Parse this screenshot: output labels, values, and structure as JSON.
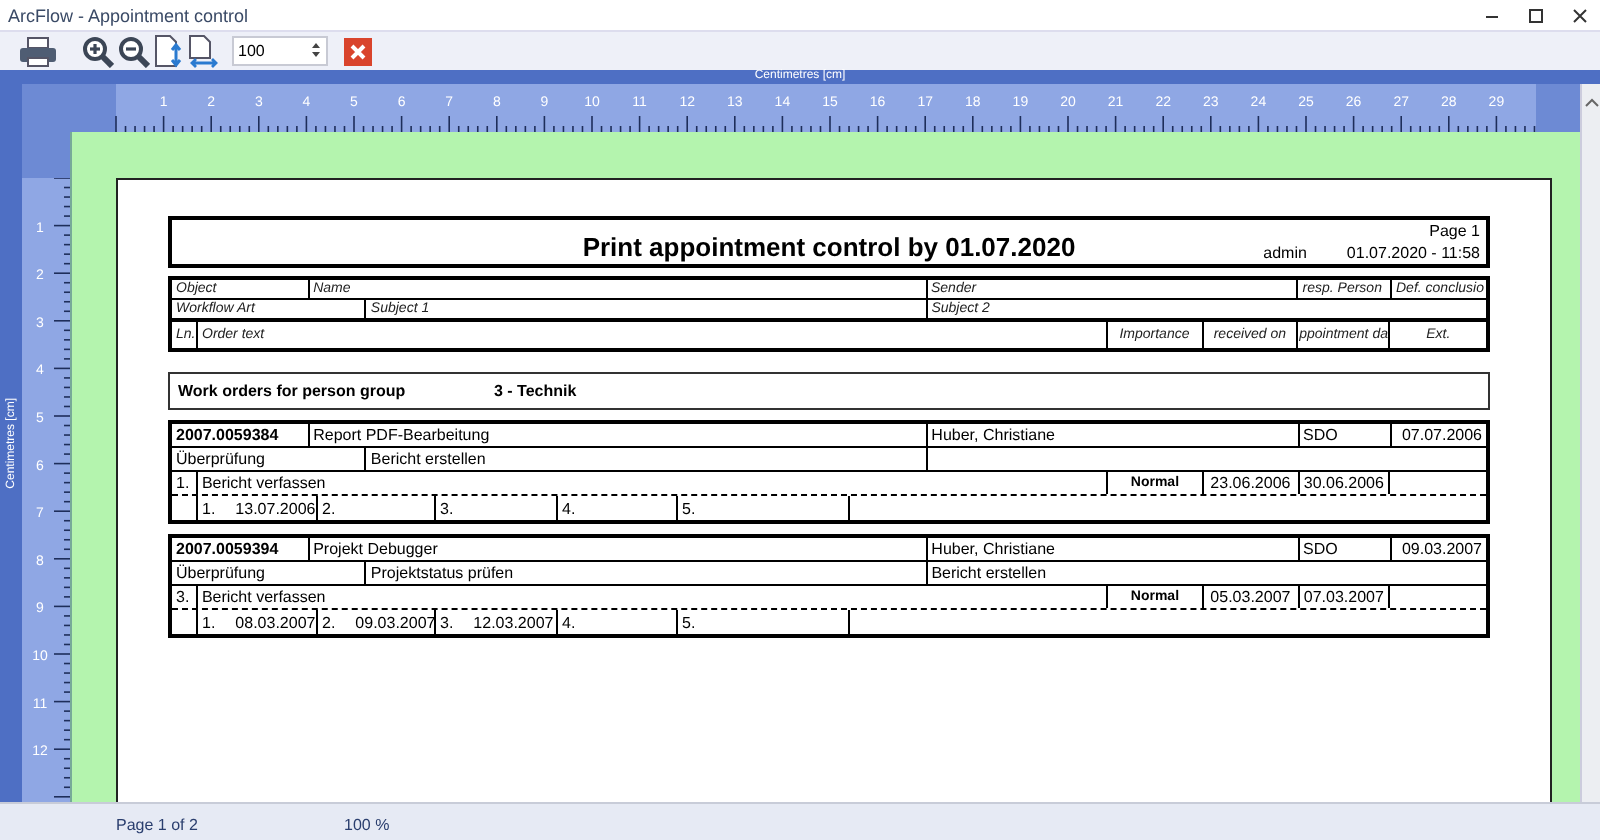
{
  "window": {
    "title": "ArcFlow - Appointment control"
  },
  "toolbar": {
    "zoom_value": "100"
  },
  "rulers": {
    "horizontal_label": "Centimetres [cm]",
    "horizontal_numbers": [
      "1",
      "2",
      "3",
      "4",
      "5",
      "6",
      "7",
      "8",
      "9",
      "10",
      "11",
      "12",
      "13",
      "14",
      "15",
      "16",
      "17",
      "18",
      "19",
      "20",
      "21",
      "22",
      "23",
      "24",
      "25",
      "26",
      "27",
      "28",
      "29"
    ],
    "vertical_label": "Centimetres [cm]",
    "vertical_numbers": [
      "1",
      "2",
      "3",
      "4",
      "5",
      "6",
      "7",
      "8",
      "9",
      "10",
      "11",
      "12"
    ]
  },
  "report": {
    "title": "Print appointment control by 01.07.2020",
    "page": "Page 1",
    "user": "admin",
    "timestamp": "01.07.2020 - 11:58",
    "column_headers": {
      "row_1": [
        "Object",
        "Name",
        "Sender",
        "resp. Person",
        "Def. conclusio"
      ],
      "row_2": [
        "Workflow Art",
        "Subject 1",
        "Subject 2"
      ],
      "row_3": [
        "Ln.",
        "Order text",
        "Importance",
        "received on",
        "ppointment da",
        "Ext."
      ]
    },
    "group": {
      "label": "Work orders for person group",
      "value": "3 - Technik"
    },
    "orders": [
      {
        "number": "2007.0059384",
        "name": "Report PDF-Bearbeitung",
        "sender": "Huber, Christiane",
        "person": "SDO",
        "date": "07.07.2006",
        "workflow_art": "Überprüfung",
        "subject_1": "Bericht erstellen",
        "line": "1.",
        "order_text": "Bericht verfassen",
        "importance": "Normal",
        "received_on": "23.06.2006",
        "appointment_date": "30.06.2006",
        "reminders": [
          {
            "number": "1.",
            "date": "13.07.2006"
          },
          {
            "number": "2."
          },
          {
            "number": "3."
          },
          {
            "number": "4."
          },
          {
            "number": "5."
          }
        ]
      },
      {
        "number": "2007.0059394",
        "name": "Projekt Debugger",
        "sender": "Huber, Christiane",
        "person": "SDO",
        "date": "09.03.2007",
        "workflow_art": "Überprüfung",
        "subject_1": "Projektstatus prüfen",
        "subject_2": "Bericht erstellen",
        "line": "3.",
        "order_text": "Bericht verfassen",
        "importance": "Normal",
        "received_on": "05.03.2007",
        "appointment_date": "07.03.2007",
        "reminders": [
          {
            "number": "1.",
            "date": "08.03.2007"
          },
          {
            "number": "2.",
            "date": "09.03.2007"
          },
          {
            "number": "3.",
            "date": "12.03.2007"
          },
          {
            "number": "4."
          },
          {
            "number": "5."
          }
        ]
      }
    ]
  },
  "status_bar": {
    "page": "Page 1 of 2",
    "zoom": "100 %"
  }
}
